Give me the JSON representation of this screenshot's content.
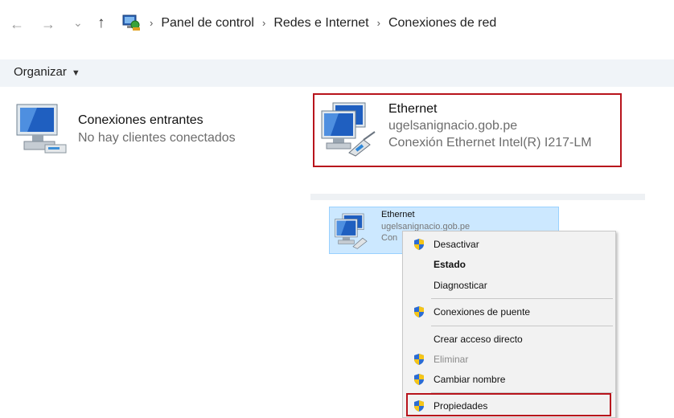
{
  "address_bar": {
    "back_arrow": "←",
    "forward_arrow": "→",
    "recent_arrow": "⌄",
    "up_arrow": "↑",
    "breadcrumbs": [
      "Panel de control",
      "Redes e Internet",
      "Conexiones de red"
    ],
    "separator": "›"
  },
  "toolbar": {
    "organize_label": "Organizar",
    "organize_caret": "▼"
  },
  "connections": [
    {
      "name": "Conexiones entrantes",
      "detail": "No hay clientes conectados"
    },
    {
      "name": "Ethernet",
      "domain": "ugelsanignacio.gob.pe",
      "adapter": "Conexión Ethernet Intel(R) I217-LM"
    }
  ],
  "drag_item": {
    "name": "Ethernet",
    "domain": "ugelsanignacio.gob.pe",
    "adapter_partial": "Con"
  },
  "context_menu": {
    "items": [
      {
        "label": "Desactivar",
        "icon": "shield-icon"
      },
      {
        "label": "Estado",
        "bold": true
      },
      {
        "label": "Diagnosticar"
      },
      {
        "label": "Conexiones de puente",
        "icon": "shield-icon"
      },
      {
        "label": "Crear acceso directo"
      },
      {
        "label": "Eliminar",
        "icon": "shield-icon",
        "disabled": true
      },
      {
        "label": "Cambiar nombre",
        "icon": "shield-icon"
      },
      {
        "label": "Propiedades",
        "icon": "shield-icon"
      }
    ]
  },
  "colors": {
    "highlight_border": "#b8141c",
    "selection_bg": "#cce8ff",
    "toolbar_bg": "#f0f4f8"
  }
}
